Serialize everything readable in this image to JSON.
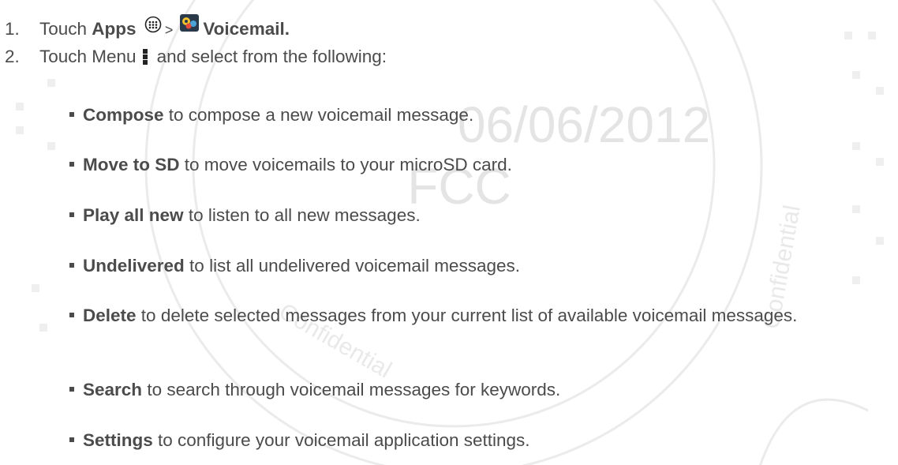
{
  "colors": {
    "text": "#4b4b4b",
    "watermark": "#e4e4e4",
    "watermark_stroke": "#ebebeb"
  },
  "watermark": {
    "date": "06/06/2012",
    "agency": "FCC",
    "ring_text_left": "Confidential",
    "ring_text_bottom": "Confidential"
  },
  "steps": [
    {
      "num": "1.",
      "text_before": "Touch ",
      "bold1": "Apps",
      "icon1": "apps-grid-icon",
      "separator": ">",
      "icon2": "voicemail-app-icon",
      "bold2": "Voicemail."
    },
    {
      "num": "2.",
      "text_before": "Touch Menu",
      "icon": "menu-overflow-icon",
      "text_after": "and select from the following:"
    }
  ],
  "options": [
    {
      "term": "Compose",
      "desc": " to compose a new voicemail message."
    },
    {
      "term": "Move to SD",
      "desc": " to move voicemails to your microSD card."
    },
    {
      "term": "Play all new",
      "desc": " to listen to all new messages."
    },
    {
      "term": "Undelivered",
      "desc": " to list all undelivered voicemail messages."
    },
    {
      "term": "Delete",
      "desc": " to delete selected messages from your current list of available voicemail messages."
    },
    {
      "term": "Search",
      "desc": " to search through voicemail messages for keywords."
    },
    {
      "term": "Settings",
      "desc": " to configure your voicemail application settings."
    }
  ]
}
